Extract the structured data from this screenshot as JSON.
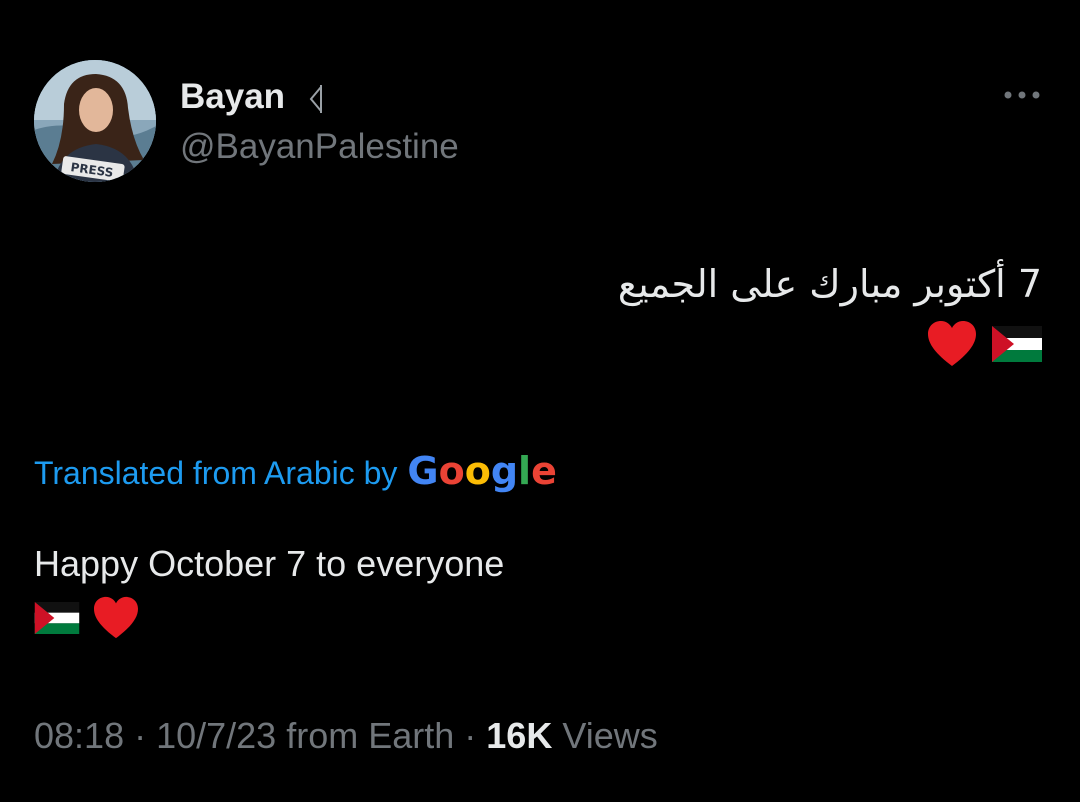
{
  "tweet": {
    "author": {
      "display_name": "Bayan",
      "handle": "@BayanPalestine",
      "avatar_vest_text": "PRESS"
    },
    "text_original": "7 أكتوبر مبارك على الجميع",
    "emoji_original": [
      "palestine-flag",
      "red-heart"
    ],
    "translation": {
      "label": "Translated from Arabic by",
      "provider": "Google",
      "text": "Happy October 7 to everyone",
      "emoji": [
        "palestine-flag",
        "red-heart"
      ]
    },
    "meta": {
      "time": "08:18",
      "separator1": " · ",
      "date": "10/7/23",
      "source": " from Earth",
      "separator2": " · ",
      "views_count": "16K",
      "views_label": " Views"
    }
  },
  "colors": {
    "background": "#000000",
    "text_primary": "#e7e9ea",
    "text_secondary": "#71767b",
    "link_blue": "#1d9bf0",
    "flag_red": "#ce1126",
    "flag_green": "#007a3d",
    "heart_red": "#e81c24"
  }
}
